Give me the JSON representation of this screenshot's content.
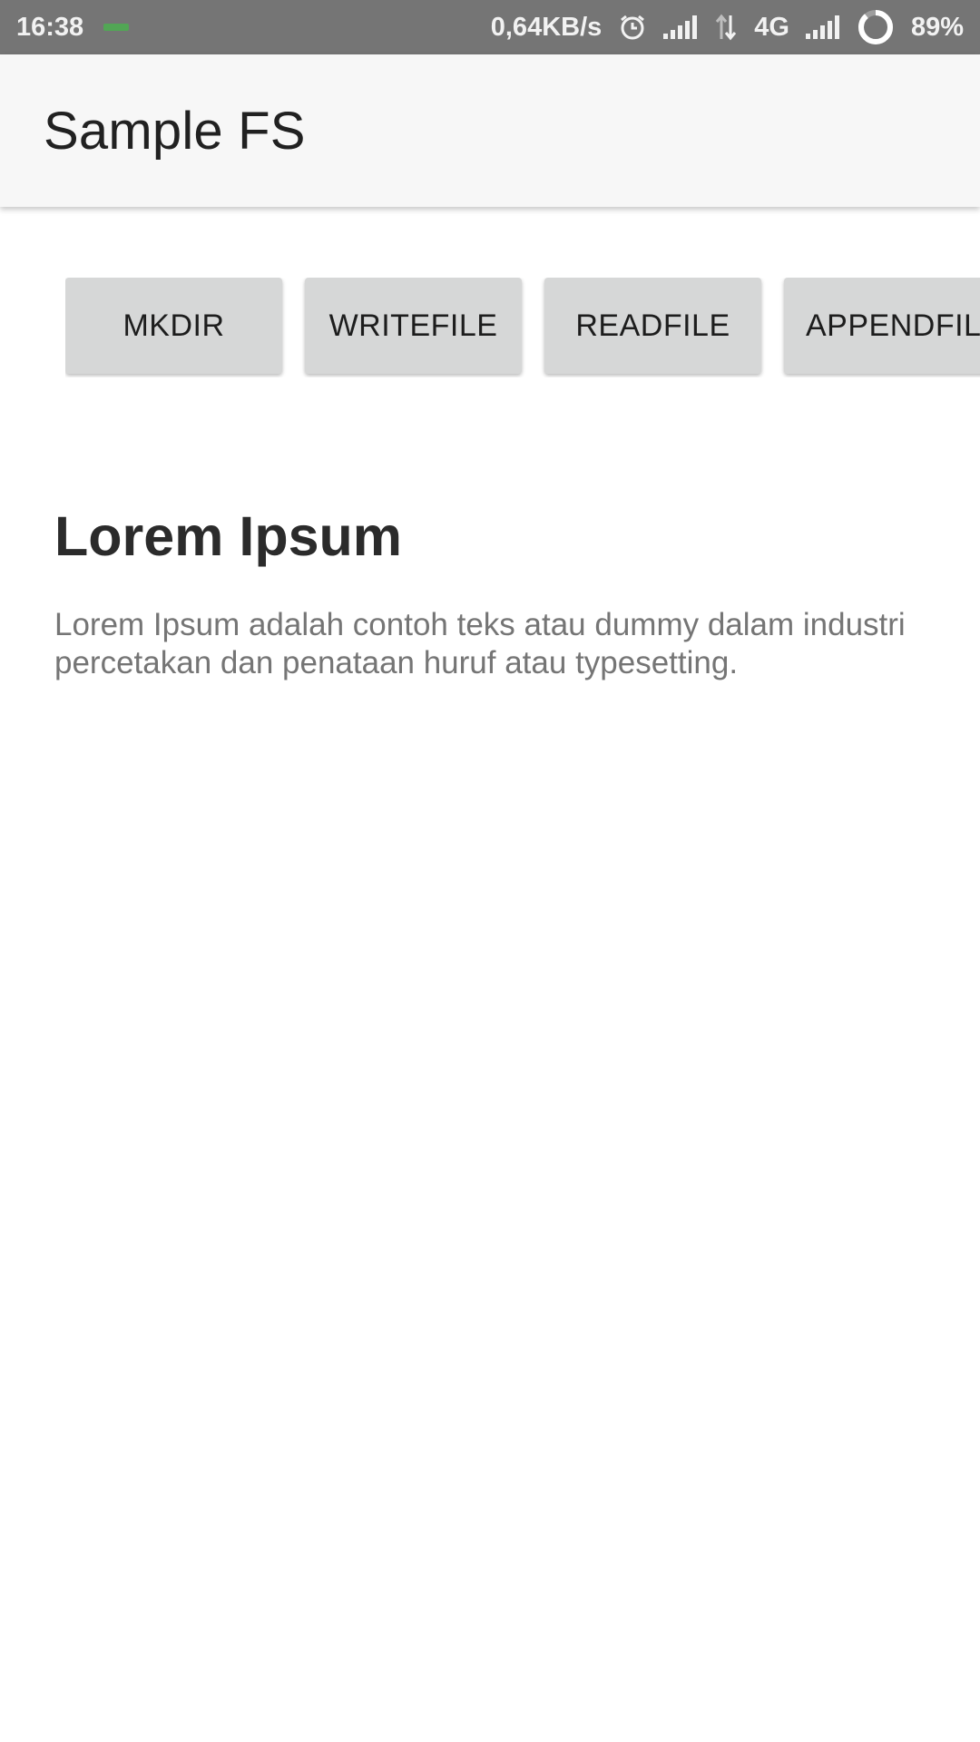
{
  "status_bar": {
    "time": "16:38",
    "network_speed": "0,64KB/s",
    "network_type": "4G",
    "battery": "89%",
    "icons": [
      "alarm-icon",
      "signal-icon",
      "data-arrows-icon",
      "signal-icon",
      "battery-ring-icon"
    ]
  },
  "app_bar": {
    "title": "Sample FS"
  },
  "buttons": {
    "mkdir": "MKDIR",
    "writefile": "WRITEFILE",
    "readfile": "READFILE",
    "appendfile": "APPENDFIL"
  },
  "content": {
    "title": "Lorem Ipsum",
    "body": "Lorem Ipsum adalah contoh teks atau dummy dalam industri percetakan dan penataan huruf atau typesetting."
  },
  "colors": {
    "status_bar": "#757575",
    "app_bar": "#f7f7f7",
    "button": "#d6d7d7",
    "title_text": "#2b2b2b",
    "body_text": "#757575"
  }
}
